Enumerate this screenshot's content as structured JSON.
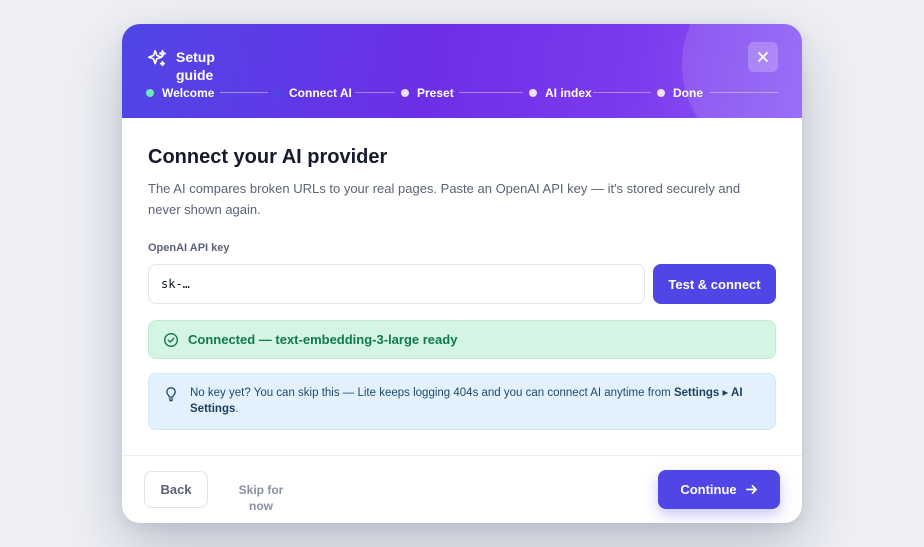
{
  "header": {
    "title": "Setup guide",
    "close_icon": "close-icon",
    "brand_icon": "sparkles-icon",
    "steps": [
      {
        "label": "Welcome",
        "state": "done"
      },
      {
        "label": "Connect AI",
        "state": "current"
      },
      {
        "label": "Preset",
        "state": "upcoming"
      },
      {
        "label": "AI index",
        "state": "upcoming"
      },
      {
        "label": "Done",
        "state": "upcoming"
      }
    ]
  },
  "content": {
    "title": "Connect your AI provider",
    "description": "The AI compares broken URLs to your real pages. Paste an OpenAI API key — it's stored securely and never shown again.",
    "field_label": "OpenAI API key",
    "api_input_value": "sk-…",
    "test_button": "Test & connect",
    "success_message": "Connected — text-embedding-3-large ready",
    "info": {
      "text_before": "No key yet? You can skip this — Lite keeps logging 404s and you can connect AI anytime from ",
      "link": "Settings ▸ AI Settings",
      "text_after": "."
    }
  },
  "footer": {
    "back": "Back",
    "skip": "Skip for now",
    "continue": "Continue"
  },
  "colors": {
    "accent": "#4f46e5",
    "header_gradient_end": "#8b5cf6",
    "success_bg": "#d5f5e4",
    "success_text": "#0f7a4a",
    "info_bg": "#e3f1fc"
  }
}
